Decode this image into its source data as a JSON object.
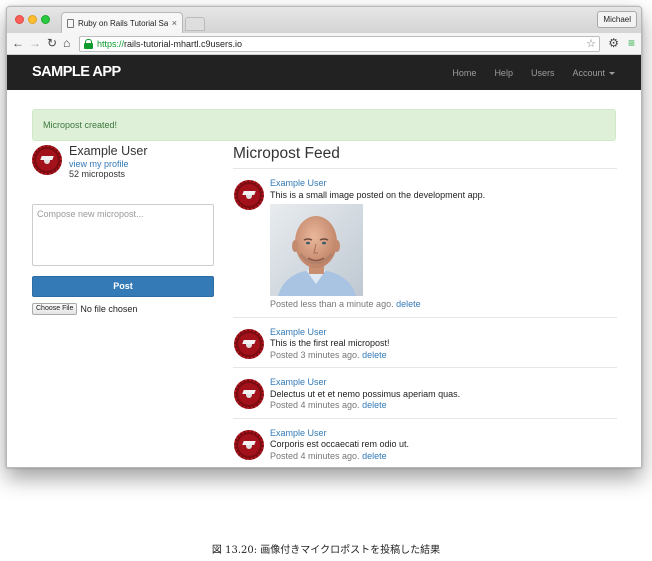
{
  "browser": {
    "tab_title": "Ruby on Rails Tutorial Samp",
    "tab_close": "×",
    "profile": "Michael",
    "url_scheme": "https://",
    "url_host": "rails-tutorial-mhartl.c9users.io"
  },
  "app": {
    "logo": "SAMPLE APP",
    "nav": [
      "Home",
      "Help",
      "Users",
      "Account"
    ]
  },
  "flash": "Micropost created!",
  "user": {
    "name": "Example User",
    "profile_link": "view my profile",
    "micropost_count": "52 microposts"
  },
  "compose": {
    "placeholder": "Compose new micropost...",
    "submit": "Post",
    "choose_file": "Choose File",
    "no_file": "No file chosen"
  },
  "feed": {
    "title": "Micropost Feed",
    "delete_label": "delete",
    "posts": [
      {
        "user": "Example User",
        "content": "This is a small image posted on the development app.",
        "time": "Posted less than a minute ago.",
        "has_image": true
      },
      {
        "user": "Example User",
        "content": "This is the first real micropost!",
        "time": "Posted 3 minutes ago."
      },
      {
        "user": "Example User",
        "content": "Delectus ut et et nemo possimus aperiam quas.",
        "time": "Posted 4 minutes ago."
      },
      {
        "user": "Example User",
        "content": "Corporis est occaecati rem odio ut.",
        "time": "Posted 4 minutes ago."
      }
    ]
  },
  "caption": "図 13.20:   画像付きマイクロポストを投稿した結果",
  "colors": {
    "navbar": "#222222",
    "link": "#337ab7",
    "primary_button": "#337ab7",
    "alert_bg": "#dff0d8",
    "alert_text": "#3c763d",
    "gravatar": "#a3121a"
  },
  "icons": {
    "back": "arrow-left-icon",
    "forward": "arrow-right-icon",
    "reload": "reload-icon",
    "home": "home-icon",
    "secure": "lock-icon",
    "bookmark": "star-icon",
    "extension": "gear-icon",
    "menu": "menu-icon"
  }
}
